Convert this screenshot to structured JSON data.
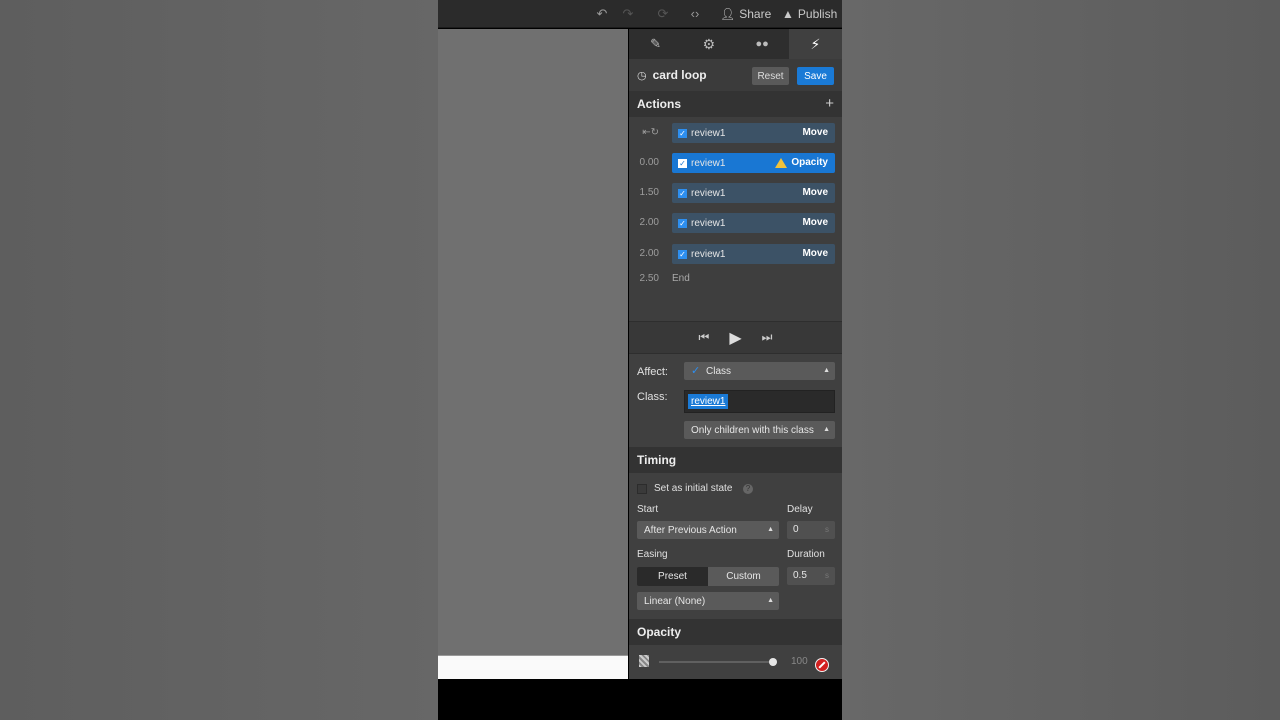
{
  "topbar": {
    "undo_icon": "undo-icon",
    "redo_icon": "redo-icon",
    "refresh_icon": "refresh-icon",
    "code_icon": "code-icon",
    "share_label": "Share",
    "publish_label": "Publish"
  },
  "tabs": [
    {
      "icon": "brush-icon",
      "active": false
    },
    {
      "icon": "gear-icon",
      "active": false
    },
    {
      "icon": "drops-icon",
      "active": false
    },
    {
      "icon": "lightning-icon",
      "active": true
    }
  ],
  "interaction": {
    "title": "card loop",
    "reset_label": "Reset",
    "save_label": "Save"
  },
  "actions": {
    "header": "Actions",
    "rows": [
      {
        "time": "",
        "name": "review1",
        "type": "Move",
        "selected": false,
        "warning": false
      },
      {
        "time": "0.00",
        "name": "review1",
        "type": "Opacity",
        "selected": true,
        "warning": true
      },
      {
        "time": "1.50",
        "name": "review1",
        "type": "Move",
        "selected": false,
        "warning": false
      },
      {
        "time": "2.00",
        "name": "review1",
        "type": "Move",
        "selected": false,
        "warning": false
      },
      {
        "time": "2.00",
        "name": "review1",
        "type": "Move",
        "selected": false,
        "warning": false
      }
    ],
    "end_time": "2.50",
    "end_label": "End"
  },
  "affect": {
    "label": "Affect:",
    "value": "Class",
    "class_label": "Class:",
    "class_token": "review1",
    "scope": "Only children with this class"
  },
  "timing": {
    "header": "Timing",
    "initial_state_label": "Set as initial state",
    "start_label": "Start",
    "start_value": "After Previous Action",
    "delay_label": "Delay",
    "delay_value": "0",
    "delay_unit": "s",
    "easing_label": "Easing",
    "preset_label": "Preset",
    "custom_label": "Custom",
    "duration_label": "Duration",
    "duration_value": "0.5",
    "duration_unit": "s",
    "easing_value": "Linear (None)"
  },
  "opacity": {
    "header": "Opacity",
    "value": "100",
    "level_percent": 100
  }
}
